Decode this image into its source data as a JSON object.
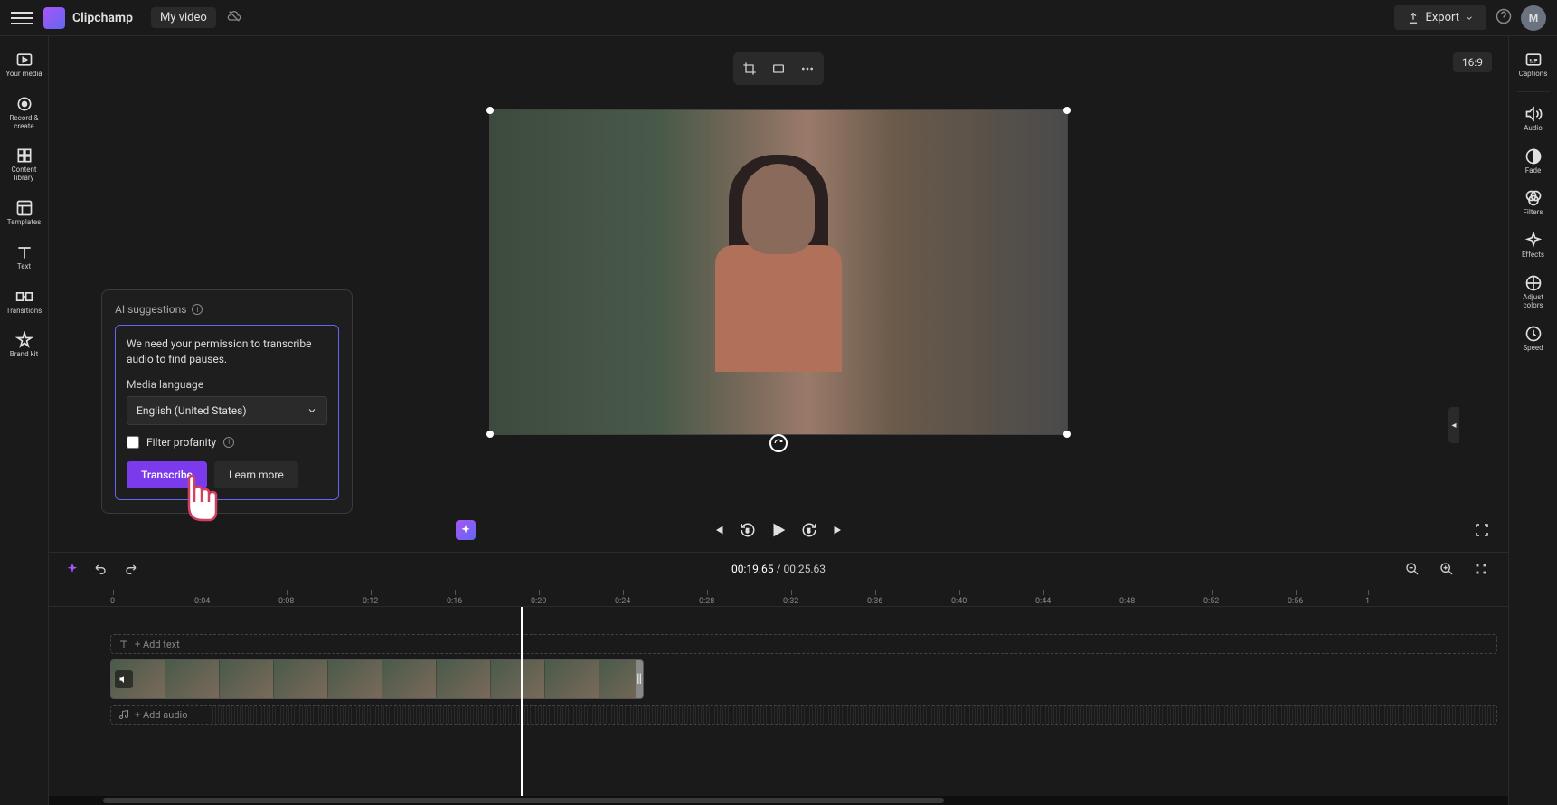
{
  "brand": {
    "name": "Clipchamp"
  },
  "header": {
    "title": "My video",
    "export_label": "Export",
    "aspect_ratio": "16:9",
    "avatar_initial": "M"
  },
  "left_sidebar": {
    "items": [
      {
        "label": "Your media"
      },
      {
        "label": "Record & create"
      },
      {
        "label": "Content library"
      },
      {
        "label": "Templates"
      },
      {
        "label": "Text"
      },
      {
        "label": "Transitions"
      },
      {
        "label": "Brand kit"
      }
    ]
  },
  "right_sidebar": {
    "items": [
      {
        "label": "Captions"
      },
      {
        "label": "Audio"
      },
      {
        "label": "Fade"
      },
      {
        "label": "Filters"
      },
      {
        "label": "Effects"
      },
      {
        "label": "Adjust colors"
      },
      {
        "label": "Speed"
      }
    ]
  },
  "ai_panel": {
    "title": "AI suggestions",
    "body": "We need your permission to transcribe audio to find pauses.",
    "media_label": "Media language",
    "language": "English (United States)",
    "filter_label": "Filter profanity",
    "transcribe_btn": "Transcribe",
    "learn_btn": "Learn more"
  },
  "playback": {
    "current": "00:19.65",
    "total": "00:25.63",
    "separator": " / "
  },
  "timeline": {
    "ruler": [
      "0",
      "0:04",
      "0:08",
      "0:12",
      "0:16",
      "0:20",
      "0:24",
      "0:28",
      "0:32",
      "0:36",
      "0:40",
      "0:44",
      "0:48",
      "0:52",
      "0:56",
      "1"
    ],
    "text_track": "+ Add text",
    "audio_track": "+ Add audio"
  }
}
